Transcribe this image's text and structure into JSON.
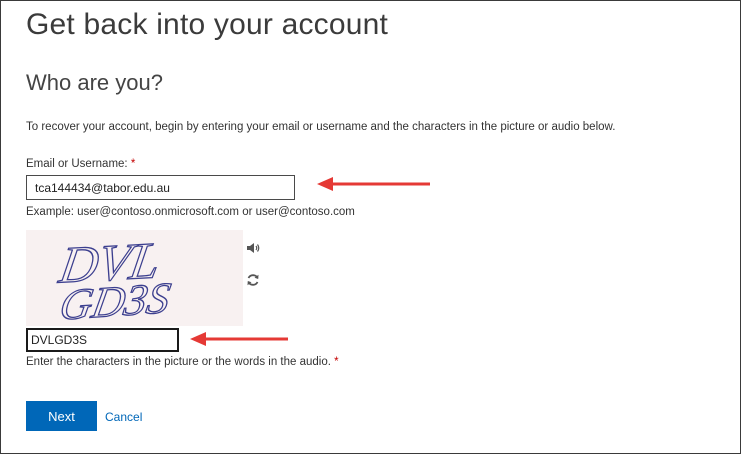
{
  "header": {
    "title": "Get back into your account"
  },
  "form": {
    "section_title": "Who are you?",
    "instruction": "To recover your account, begin by entering your email or username and the characters in the picture or audio below.",
    "email": {
      "label": "Email or Username: ",
      "required_mark": "*",
      "value": "tca144434@tabor.edu.au",
      "example": "Example: user@contoso.onmicrosoft.com or user@contoso.com"
    },
    "captcha": {
      "image_text": "DVLGD3S",
      "image_line1": "DVL",
      "image_line2": "GD3S",
      "audio_icon": "speaker-icon",
      "refresh_icon": "refresh-icon",
      "value": "DVLGD3S",
      "hint": "Enter the characters in the picture or the words in the audio. ",
      "required_mark": "*"
    },
    "actions": {
      "next_label": "Next",
      "cancel_label": "Cancel"
    }
  },
  "colors": {
    "accent": "#0067b8",
    "required": "#c40000",
    "annotation_arrow": "#e53935"
  }
}
